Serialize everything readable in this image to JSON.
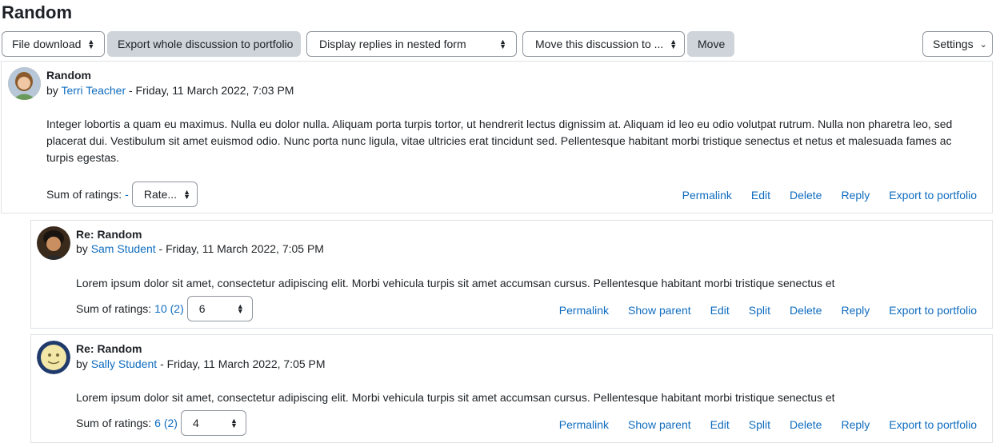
{
  "page": {
    "title": "Random"
  },
  "toolbar": {
    "file_download": "File download",
    "export_discussion": "Export whole discussion to portfolio",
    "display_mode": "Display replies in nested form",
    "move_to": "Move this discussion to ...",
    "move": "Move",
    "settings": "Settings"
  },
  "posts": [
    {
      "subject": "Random",
      "by": "by",
      "author": "Terri Teacher",
      "date": " - Friday, 11 March 2022, 7:03 PM",
      "body": "Integer lobortis a quam eu maximus. Nulla eu dolor nulla. Aliquam porta turpis tortor, ut hendrerit lectus dignissim at. Aliquam id leo eu odio volutpat rutrum. Nulla non pharetra leo, sed placerat dui. Vestibulum sit amet euismod odio. Nunc porta nunc ligula, vitae ultricies erat tincidunt sed. Pellentesque habitant morbi tristique senectus et netus et malesuada fames ac turpis egestas.",
      "ratings_label": "Sum of ratings:",
      "ratings_value": "-",
      "rate_select": "Rate...",
      "commands": [
        "Permalink",
        "Edit",
        "Delete",
        "Reply",
        "Export to portfolio"
      ]
    },
    {
      "subject": "Re: Random",
      "by": "by",
      "author": "Sam Student",
      "date": " - Friday, 11 March 2022, 7:05 PM",
      "body": "Lorem ipsum dolor sit amet, consectetur adipiscing elit. Morbi vehicula turpis sit amet accumsan cursus. Pellentesque habitant morbi tristique senectus et",
      "ratings_label": "Sum of ratings:",
      "ratings_value": "10 (2)",
      "rate_select": "6",
      "commands": [
        "Permalink",
        "Show parent",
        "Edit",
        "Split",
        "Delete",
        "Reply",
        "Export to portfolio"
      ]
    },
    {
      "subject": "Re: Random",
      "by": "by",
      "author": "Sally Student",
      "date": " - Friday, 11 March 2022, 7:05 PM",
      "body": "Lorem ipsum dolor sit amet, consectetur adipiscing elit. Morbi vehicula turpis sit amet accumsan cursus. Pellentesque habitant morbi tristique senectus et",
      "ratings_label": "Sum of ratings:",
      "ratings_value": "6 (2)",
      "rate_select": "4",
      "commands": [
        "Permalink",
        "Show parent",
        "Edit",
        "Split",
        "Delete",
        "Reply",
        "Export to portfolio"
      ]
    }
  ],
  "icons": {
    "updown": "updown-caret-icon",
    "chevron": "chevron-down-icon"
  }
}
